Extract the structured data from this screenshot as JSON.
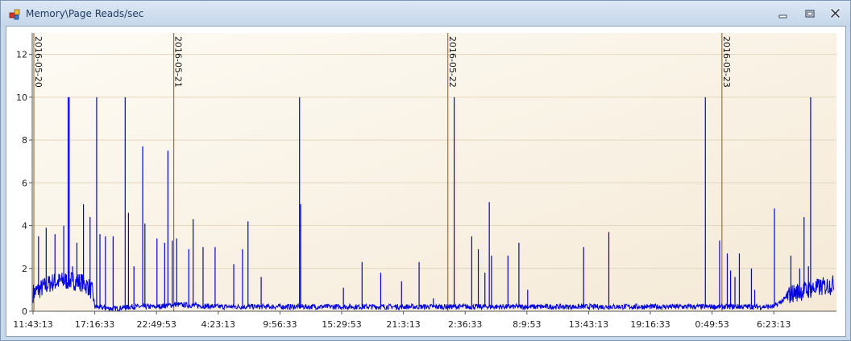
{
  "window": {
    "title": "Memory\\Page Reads/sec",
    "icon": "chart-app-icon",
    "buttons": {
      "minimize": "minimize-icon",
      "maximize": "maximize-icon",
      "close": "close-icon"
    }
  },
  "chart_data": {
    "type": "line",
    "title": "",
    "xlabel": "",
    "ylabel": "",
    "ylim": [
      0,
      13
    ],
    "y_ticks": [
      0,
      2,
      4,
      6,
      8,
      10,
      12
    ],
    "x_tick_labels": [
      "11:43:13",
      "17:16:33",
      "22:49:53",
      "4:23:13",
      "9:56:33",
      "15:29:53",
      "21:3:13",
      "2:36:33",
      "8:9:53",
      "13:43:13",
      "19:16:33",
      "0:49:53",
      "6:23:13"
    ],
    "date_markers": [
      "2016-05-20",
      "2016-05-21",
      "2016-05-22",
      "2016-05-23"
    ],
    "grid": true,
    "legend": "none",
    "colors": {
      "series": "#0000e0",
      "date_marker": "#8b5a1e",
      "grid": "#e2d6c0",
      "plot_bg_light": "#fdfbf4",
      "plot_bg_dark": "#f5e9d6"
    },
    "series": [
      {
        "x": [
          "11:43:13",
          "12:30:00",
          "13:30:00",
          "14:30:00",
          "15:30:00",
          "16:30:00",
          "17:16:33",
          "18:30:00",
          "20:00:00",
          "21:30:00",
          "22:49:53",
          "2016-05-21 0:00",
          "4:23:13",
          "9:56:33",
          "15:29:53",
          "21:3:13",
          "2:36:33",
          "8:9:53",
          "13:43:13",
          "19:16:33",
          "0:49:53",
          "4:00:00",
          "6:23:13",
          "7:30:00",
          "9:30:00"
        ],
        "values": [
          0.8,
          1.3,
          1.4,
          1.3,
          1.1,
          0.8,
          0.2,
          0.1,
          0.2,
          0.2,
          0.2,
          0.3,
          0.2,
          0.2,
          0.2,
          0.2,
          0.2,
          0.2,
          0.2,
          0.2,
          0.2,
          0.2,
          0.2,
          0.8,
          1.2
        ],
        "spikes": [
          [
            0.05,
            3.5
          ],
          [
            0.12,
            3.9
          ],
          [
            0.2,
            3.6
          ],
          [
            0.28,
            4.0
          ],
          [
            0.32,
            10.0
          ],
          [
            0.33,
            10.0
          ],
          [
            0.36,
            2.1
          ],
          [
            0.4,
            3.2
          ],
          [
            0.46,
            5.0
          ],
          [
            0.52,
            4.4
          ],
          [
            0.58,
            10.0
          ],
          [
            0.61,
            3.6
          ],
          [
            0.66,
            3.5
          ],
          [
            0.73,
            3.5
          ],
          [
            0.84,
            10.0
          ],
          [
            0.87,
            4.6
          ],
          [
            0.92,
            2.1
          ],
          [
            1.0,
            7.7
          ],
          [
            1.02,
            4.1
          ],
          [
            1.13,
            3.4
          ],
          [
            1.2,
            3.2
          ],
          [
            1.23,
            7.5
          ],
          [
            1.27,
            3.3
          ],
          [
            1.31,
            3.4
          ],
          [
            1.42,
            2.9
          ],
          [
            1.46,
            4.3
          ],
          [
            1.55,
            3.0
          ],
          [
            1.66,
            3.0
          ],
          [
            1.83,
            2.2
          ],
          [
            1.91,
            2.9
          ],
          [
            1.96,
            4.2
          ],
          [
            2.08,
            1.6
          ],
          [
            2.43,
            10.0
          ],
          [
            2.44,
            5.0
          ],
          [
            2.83,
            1.1
          ],
          [
            3.0,
            2.3
          ],
          [
            3.17,
            1.8
          ],
          [
            3.36,
            1.4
          ],
          [
            3.52,
            2.3
          ],
          [
            3.65,
            0.6
          ],
          [
            3.84,
            10.0
          ],
          [
            4.0,
            3.5
          ],
          [
            4.06,
            2.9
          ],
          [
            4.12,
            1.8
          ],
          [
            4.16,
            5.1
          ],
          [
            4.18,
            2.6
          ],
          [
            4.33,
            2.6
          ],
          [
            4.43,
            3.2
          ],
          [
            4.51,
            1.0
          ],
          [
            5.02,
            3.0
          ],
          [
            5.25,
            3.7
          ],
          [
            6.13,
            10.0
          ],
          [
            6.26,
            3.3
          ],
          [
            6.33,
            2.7
          ],
          [
            6.36,
            1.9
          ],
          [
            6.4,
            1.6
          ],
          [
            6.44,
            2.7
          ],
          [
            6.55,
            2.0
          ],
          [
            6.58,
            1.0
          ],
          [
            6.76,
            4.8
          ],
          [
            6.91,
            2.6
          ],
          [
            6.99,
            2.0
          ],
          [
            7.03,
            4.4
          ],
          [
            7.07,
            2.1
          ],
          [
            7.09,
            10.0
          ]
        ]
      }
    ]
  }
}
